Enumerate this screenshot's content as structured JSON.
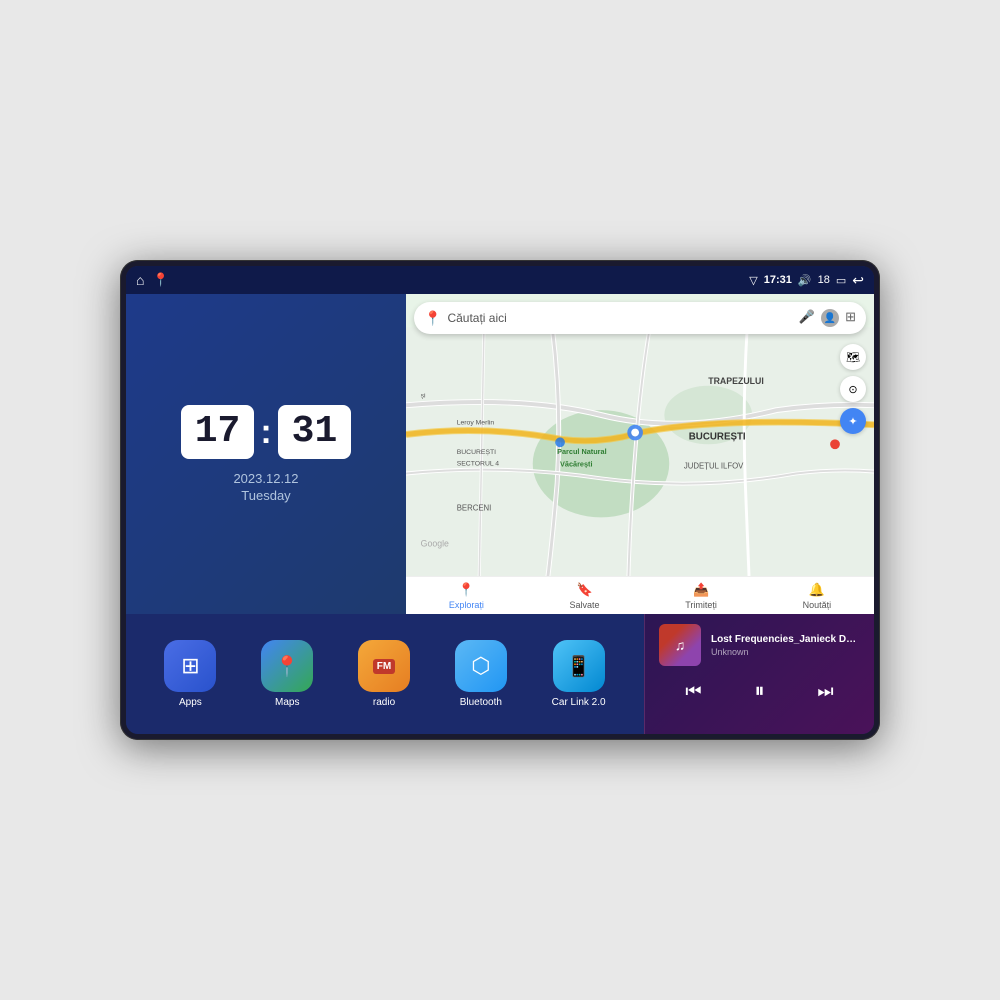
{
  "device": {
    "status_bar": {
      "left_icons": [
        "🏠",
        "📍"
      ],
      "time": "17:31",
      "signal_icon": "▽",
      "volume_icon": "🔊",
      "battery_level": "18",
      "battery_icon": "🔋",
      "back_icon": "↩"
    },
    "clock": {
      "hours": "17",
      "minutes": "31",
      "date": "2023.12.12",
      "day": "Tuesday"
    },
    "map": {
      "search_placeholder": "Căutați aici",
      "nav_items": [
        {
          "label": "Explorați",
          "active": true
        },
        {
          "label": "Salvate",
          "active": false
        },
        {
          "label": "Trimiteți",
          "active": false
        },
        {
          "label": "Noutăți",
          "active": false
        }
      ],
      "labels": [
        "TRAPEZULUI",
        "BUCUREȘTI",
        "JUDEȚUL ILFOV",
        "BERCENI",
        "Parcul Natural Văcărești",
        "Leroy Merlin",
        "BUCUREȘTI\nSECTORUL 4"
      ]
    },
    "apps": [
      {
        "id": "apps",
        "label": "Apps",
        "icon": "⊞",
        "color_class": "icon-apps"
      },
      {
        "id": "maps",
        "label": "Maps",
        "icon": "📍",
        "color_class": "icon-maps"
      },
      {
        "id": "radio",
        "label": "radio",
        "icon": "📻",
        "color_class": "icon-radio"
      },
      {
        "id": "bluetooth",
        "label": "Bluetooth",
        "icon": "⬡",
        "color_class": "icon-bluetooth"
      },
      {
        "id": "carlink",
        "label": "Car Link 2.0",
        "icon": "📱",
        "color_class": "icon-carlink"
      }
    ],
    "music": {
      "title": "Lost Frequencies_Janieck Devy-...",
      "artist": "Unknown",
      "prev_label": "⏮",
      "play_label": "⏸",
      "next_label": "⏭"
    }
  }
}
